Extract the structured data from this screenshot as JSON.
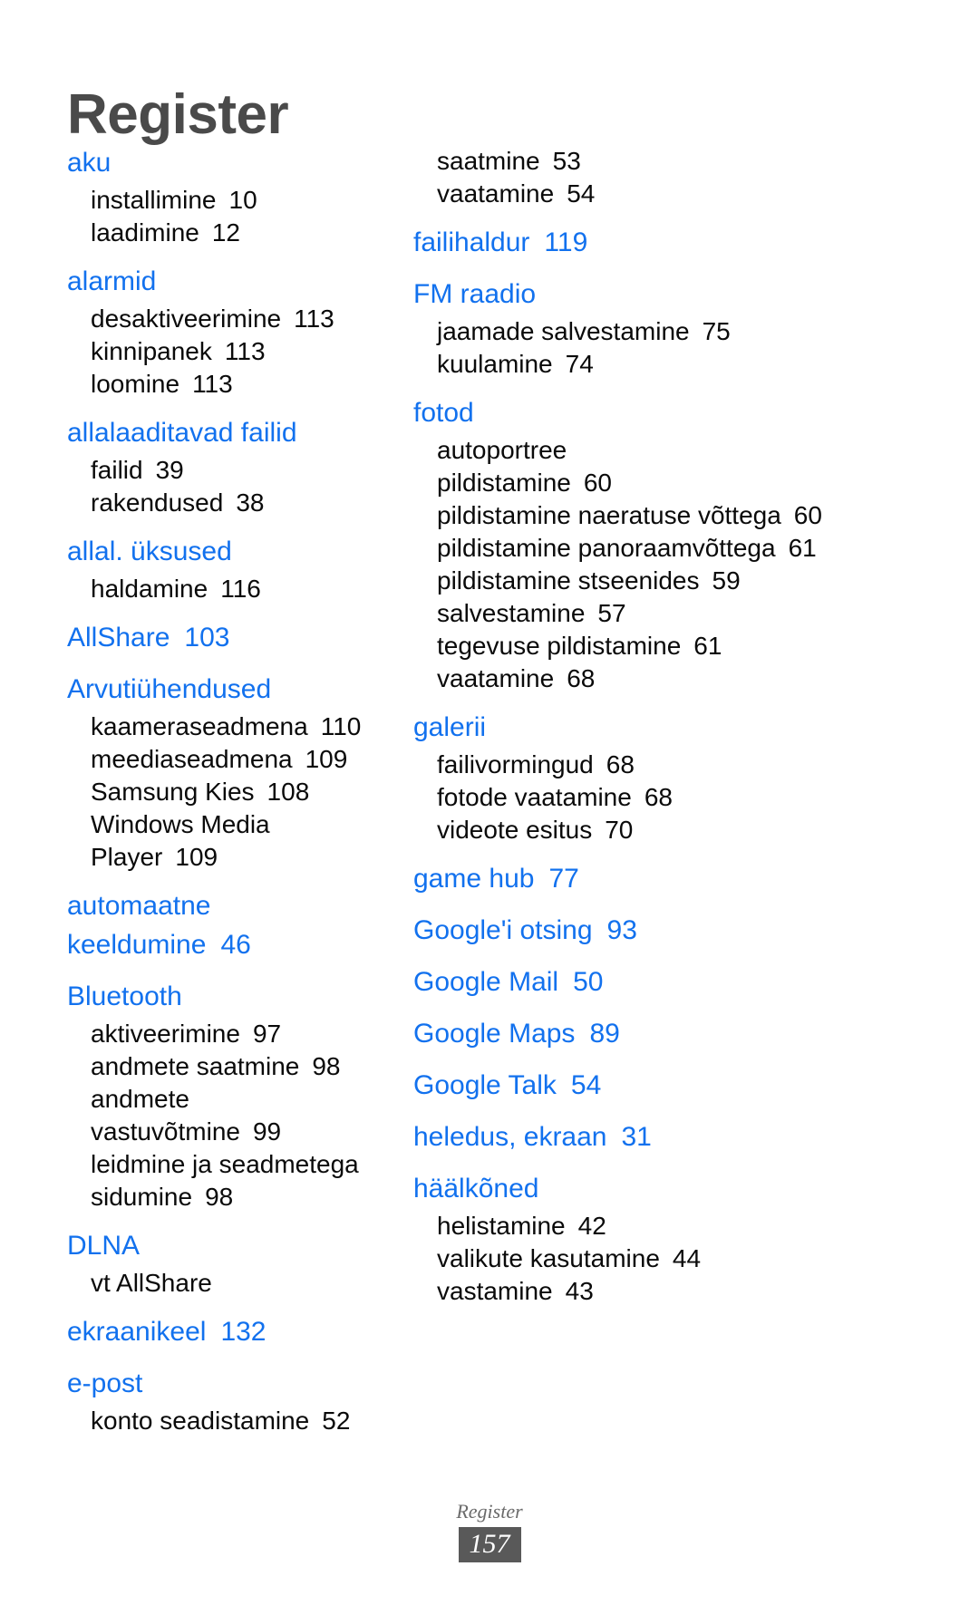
{
  "page": {
    "title": "Register",
    "footer_label": "Register",
    "page_number": "157",
    "accent_color": "#1271ee",
    "title_color": "#4a4a4a",
    "body_color": "#0a0a0a",
    "footer_color": "#6b6b6b",
    "badge_bg": "#595959"
  },
  "left_column": [
    {
      "head": "aku",
      "head_page": "",
      "subs": [
        {
          "label": "installimine",
          "page": "10"
        },
        {
          "label": "laadimine",
          "page": "12"
        }
      ]
    },
    {
      "head": "alarmid",
      "head_page": "",
      "subs": [
        {
          "label": "desaktiveerimine",
          "page": "113"
        },
        {
          "label": "kinnipanek",
          "page": "113"
        },
        {
          "label": "loomine",
          "page": "113"
        }
      ]
    },
    {
      "head": "allalaaditavad failid",
      "head_page": "",
      "subs": [
        {
          "label": "failid",
          "page": "39"
        },
        {
          "label": "rakendused",
          "page": "38"
        }
      ]
    },
    {
      "head": "allal. üksused",
      "head_page": "",
      "subs": [
        {
          "label": "haldamine",
          "page": "116"
        }
      ]
    },
    {
      "head": "AllShare",
      "head_page": "103",
      "subs": []
    },
    {
      "head": "Arvutiühendused",
      "head_page": "",
      "subs": [
        {
          "label": "kaameraseadmena",
          "page": "110"
        },
        {
          "label": "meediaseadmena",
          "page": "109"
        },
        {
          "label": "Samsung Kies",
          "page": "108"
        },
        {
          "label": "Windows Media Player",
          "page": "109"
        }
      ]
    },
    {
      "head": "automaatne keeldumine",
      "head_page": "46",
      "subs": []
    },
    {
      "head": "Bluetooth",
      "head_page": "",
      "subs": [
        {
          "label": "aktiveerimine",
          "page": "97"
        },
        {
          "label": "andmete saatmine",
          "page": "98"
        },
        {
          "label": "andmete vastuvõtmine",
          "page": "99"
        },
        {
          "label": "leidmine ja seadmetega sidumine",
          "page": "98"
        }
      ]
    },
    {
      "head": "DLNA",
      "head_page": "",
      "subs": [
        {
          "label": "vt AllShare",
          "page": ""
        }
      ]
    },
    {
      "head": "ekraanikeel",
      "head_page": "132",
      "subs": []
    },
    {
      "head": "e-post",
      "head_page": "",
      "subs": [
        {
          "label": "konto seadistamine",
          "page": "52"
        }
      ]
    }
  ],
  "right_column": [
    {
      "head": "",
      "head_page": "",
      "subs": [
        {
          "label": "saatmine",
          "page": "53"
        },
        {
          "label": "vaatamine",
          "page": "54"
        }
      ]
    },
    {
      "head": "failihaldur",
      "head_page": "119",
      "subs": []
    },
    {
      "head": "FM raadio",
      "head_page": "",
      "subs": [
        {
          "label": "jaamade salvestamine",
          "page": "75"
        },
        {
          "label": "kuulamine",
          "page": "74"
        }
      ]
    },
    {
      "head": "fotod",
      "head_page": "",
      "subs": [
        {
          "label": "autoportree",
          "page": ""
        },
        {
          "label": "pildistamine",
          "page": "60"
        },
        {
          "label": "pildistamine naeratuse võttega",
          "page": "60"
        },
        {
          "label": "pildistamine panoraamvõttega",
          "page": "61"
        },
        {
          "label": "pildistamine stseenides",
          "page": "59"
        },
        {
          "label": "salvestamine",
          "page": "57"
        },
        {
          "label": "tegevuse pildistamine",
          "page": "61"
        },
        {
          "label": "vaatamine",
          "page": "68"
        }
      ]
    },
    {
      "head": "galerii",
      "head_page": "",
      "subs": [
        {
          "label": "failivormingud",
          "page": "68"
        },
        {
          "label": "fotode vaatamine",
          "page": "68"
        },
        {
          "label": "videote esitus",
          "page": "70"
        }
      ]
    },
    {
      "head": "game hub",
      "head_page": "77",
      "subs": []
    },
    {
      "head": "Google'i otsing",
      "head_page": "93",
      "subs": []
    },
    {
      "head": "Google Mail",
      "head_page": "50",
      "subs": []
    },
    {
      "head": "Google Maps",
      "head_page": "89",
      "subs": []
    },
    {
      "head": "Google Talk",
      "head_page": "54",
      "subs": []
    },
    {
      "head": "heledus, ekraan",
      "head_page": "31",
      "subs": []
    },
    {
      "head": "häälkõned",
      "head_page": "",
      "subs": [
        {
          "label": "helistamine",
          "page": "42"
        },
        {
          "label": "valikute kasutamine",
          "page": "44"
        },
        {
          "label": "vastamine",
          "page": "43"
        }
      ]
    }
  ]
}
